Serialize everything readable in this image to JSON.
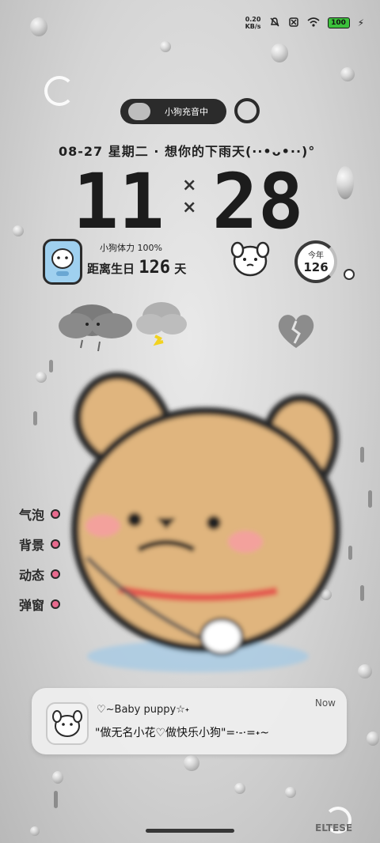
{
  "status_bar": {
    "net_speed": "0.20\nKB/s",
    "battery": "100",
    "icons": [
      "mute-icon",
      "sim-off-icon",
      "wifi-icon",
      "battery-icon",
      "charging-icon"
    ]
  },
  "pill": {
    "label": "小狗充音中"
  },
  "date_line": "08-27  星期二  · 想你的下雨天(··•ᴗ•··)°",
  "clock": {
    "hours": "11",
    "minutes": "28",
    "separator_top": "×",
    "separator_bottom": "×"
  },
  "stats": {
    "stamina": "小狗体力 100%",
    "birthday_label": "距离生日",
    "birthday_days": "126",
    "birthday_unit": "天"
  },
  "year_widget": {
    "label": "今年",
    "value": "126"
  },
  "side_menu": [
    "气泡",
    "背景",
    "动态",
    "弹窗"
  ],
  "notification": {
    "title": "♡~Baby puppy☆˖",
    "message": "\"做无名小花♡做快乐小狗\"=·-·=˖~",
    "time": "Now"
  },
  "watermark": "ELTESE",
  "colors": {
    "accent_pink": "#e86a8e",
    "dog_tan": "#e0b57e",
    "collar_red": "#e35a4f"
  }
}
